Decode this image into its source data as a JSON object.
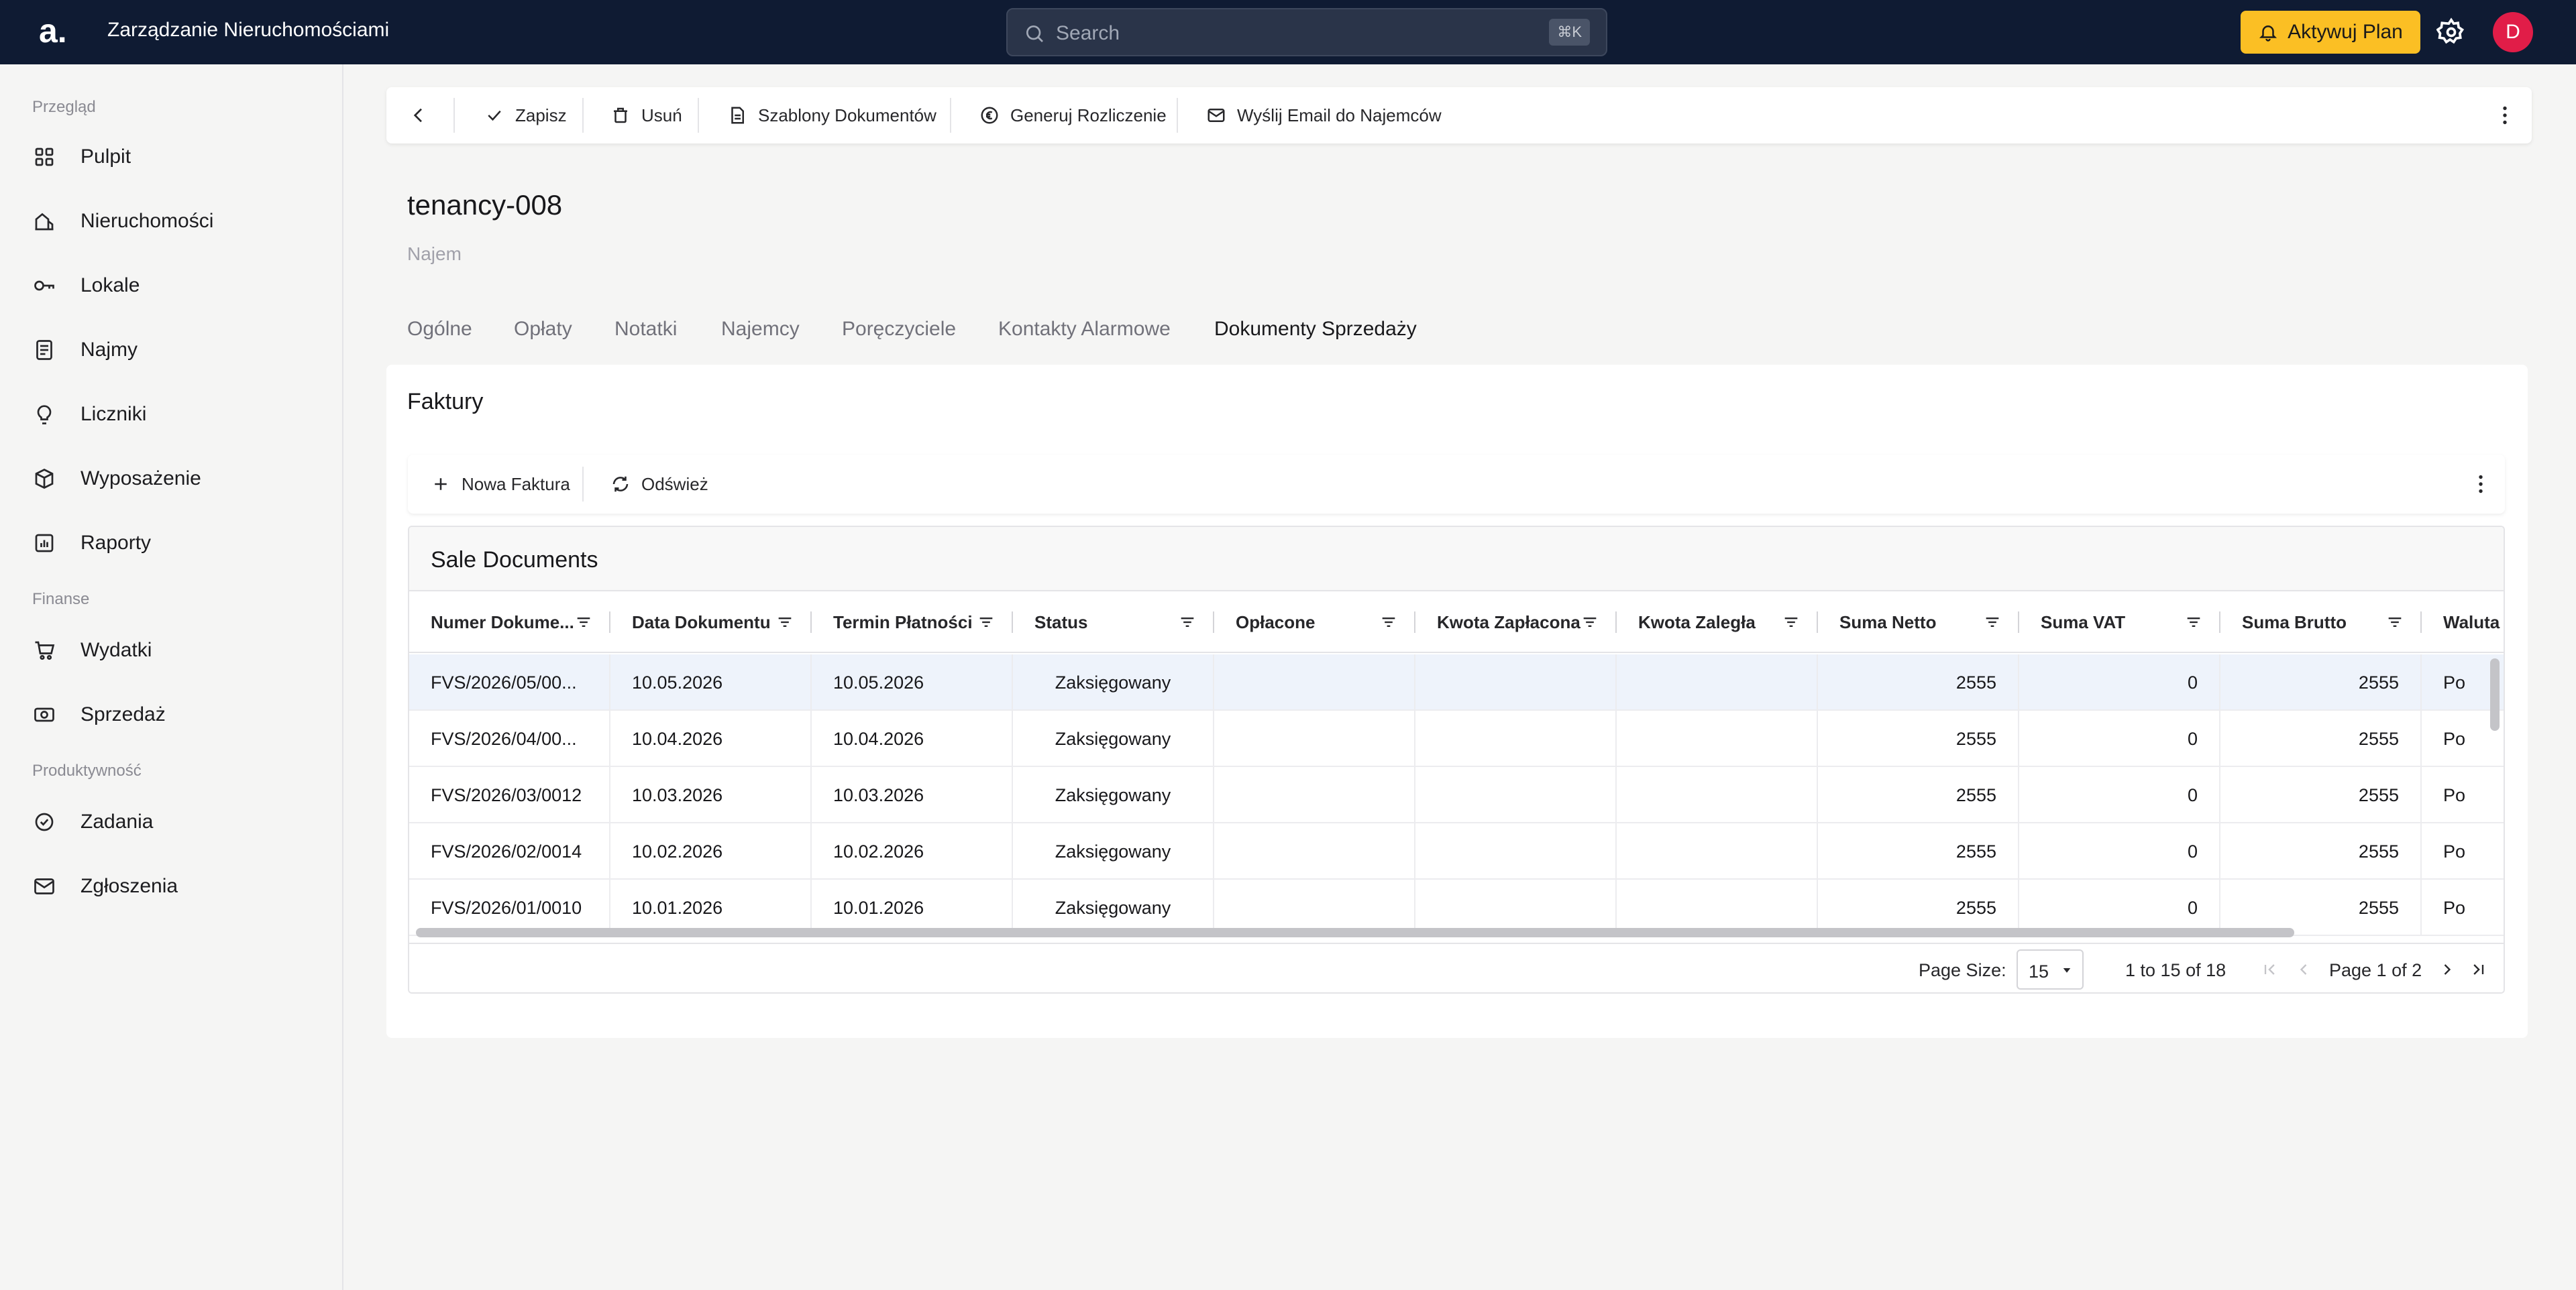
{
  "header": {
    "logo": "a.",
    "app_title": "Zarządzanie Nieruchomościami",
    "search_placeholder": "Search",
    "search_shortcut": "⌘K",
    "upgrade_label": "Aktywuj Plan",
    "avatar_initial": "D",
    "accent_color": "#fbbf24"
  },
  "sidebar": {
    "sections": {
      "overview": "Przegląd",
      "finance": "Finanse",
      "productivity": "Produktywność"
    },
    "items": [
      {
        "label": "Pulpit",
        "icon": "grid-icon"
      },
      {
        "label": "Nieruchomości",
        "icon": "building-icon"
      },
      {
        "label": "Lokale",
        "icon": "key-icon"
      },
      {
        "label": "Najmy",
        "icon": "document-icon"
      },
      {
        "label": "Liczniki",
        "icon": "bulb-icon"
      },
      {
        "label": "Wyposażenie",
        "icon": "box-icon"
      },
      {
        "label": "Raporty",
        "icon": "chart-icon"
      },
      {
        "label": "Wydatki",
        "icon": "cart-icon"
      },
      {
        "label": "Sprzedaż",
        "icon": "money-icon"
      },
      {
        "label": "Zadania",
        "icon": "check-circle-icon"
      },
      {
        "label": "Zgłoszenia",
        "icon": "mail-icon"
      }
    ]
  },
  "toolbar": {
    "save": "Zapisz",
    "delete": "Usuń",
    "templates": "Szablony Dokumentów",
    "generate": "Generuj Rozliczenie",
    "email": "Wyślij Email do Najemców"
  },
  "page": {
    "title": "tenancy-008",
    "subtitle": "Najem",
    "tabs": [
      "Ogólne",
      "Opłaty",
      "Notatki",
      "Najemcy",
      "Poręczyciele",
      "Kontakty Alarmowe",
      "Dokumenty Sprzedaży"
    ],
    "active_tab": "Dokumenty Sprzedaży"
  },
  "invoices": {
    "section_title": "Faktury",
    "new_label": "Nowa Faktura",
    "refresh_label": "Odśwież",
    "grid_title": "Sale Documents",
    "columns": [
      "Numer Dokume...",
      "Data Dokumentu",
      "Termin Płatności",
      "Status",
      "Opłacone",
      "Kwota Zapłacona",
      "Kwota Zaległa",
      "Suma Netto",
      "Suma VAT",
      "Suma Brutto",
      "Waluta"
    ],
    "rows": [
      [
        "FVS/2026/05/00...",
        "10.05.2026",
        "10.05.2026",
        "Zaksięgowany",
        "",
        "",
        "",
        "2555",
        "0",
        "2555",
        "Po"
      ],
      [
        "FVS/2026/04/00...",
        "10.04.2026",
        "10.04.2026",
        "Zaksięgowany",
        "",
        "",
        "",
        "2555",
        "0",
        "2555",
        "Po"
      ],
      [
        "FVS/2026/03/0012",
        "10.03.2026",
        "10.03.2026",
        "Zaksięgowany",
        "",
        "",
        "",
        "2555",
        "0",
        "2555",
        "Po"
      ],
      [
        "FVS/2026/02/0014",
        "10.02.2026",
        "10.02.2026",
        "Zaksięgowany",
        "",
        "",
        "",
        "2555",
        "0",
        "2555",
        "Po"
      ],
      [
        "FVS/2026/01/0010",
        "10.01.2026",
        "10.01.2026",
        "Zaksięgowany",
        "",
        "",
        "",
        "2555",
        "0",
        "2555",
        "Po"
      ]
    ],
    "pagination": {
      "page_size_label": "Page Size:",
      "page_size": "15",
      "range": "1 to 15 of 18",
      "page_info": "Page 1 of 2"
    }
  }
}
